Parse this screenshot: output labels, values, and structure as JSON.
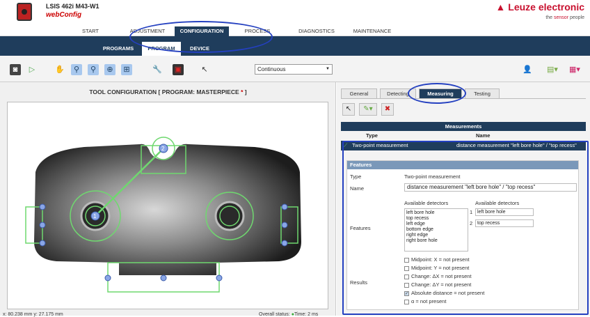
{
  "header": {
    "device": "LSIS 462i M43-W1",
    "app": "webConfig",
    "brand": "▲ Leuze electronic",
    "tagline_prefix": "the ",
    "tagline_accent": "sensor",
    "tagline_suffix": " people"
  },
  "mainnav": [
    "START",
    "ADJUSTMENT",
    "CONFIGURATION",
    "PROCESS",
    "DIAGNOSTICS",
    "MAINTENANCE"
  ],
  "subnav": [
    "PROGRAMS",
    "PROGRAM",
    "DEVICE"
  ],
  "toolbar": {
    "mode": "Continuous"
  },
  "left": {
    "title": "TOOL CONFIGURATION   [ PROGRAM: MASTERPIECE ",
    "star": "*",
    "title_end": " ]",
    "coords": "x: 80.238 mm y: 27.175 mm",
    "overall": "Overall status:",
    "time": "Time: 2 ms"
  },
  "tabs": [
    "General",
    "Detecting",
    "Measuring",
    "Testing"
  ],
  "measurements": {
    "header": "Measurements",
    "col_type": "Type",
    "col_name": "Name",
    "row_type": "Two-point measurement",
    "row_name": "distance measurement \"left bore hole\" / \"top recess\""
  },
  "features": {
    "header": "Features",
    "type_label": "Type",
    "type_value": "Two-point measurement",
    "name_label": "Name",
    "name_value": "distance measurement \"left bore hole\" / \"top recess\"",
    "features_label": "Features",
    "avail1": "Available detectors",
    "avail2": "Available detectors",
    "detectors": [
      "left bore hole",
      "top recess",
      "left edge",
      "bottom edge",
      "right edge",
      "right bore hole"
    ],
    "sel1": "left bore hole",
    "sel2": "top recess",
    "results_label": "Results",
    "results": [
      "Midpoint: X = not present",
      "Midpoint: Y = not present",
      "Change: ΔX = not present",
      "Change: ΔY = not present",
      "Absolute distance = not present",
      "α = not present"
    ]
  }
}
